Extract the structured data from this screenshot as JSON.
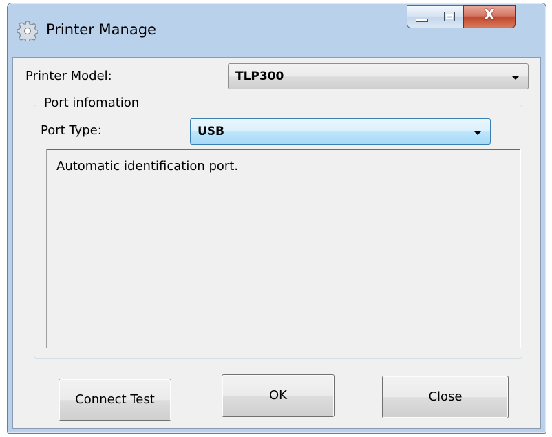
{
  "window": {
    "title": "Printer Manage",
    "icon": "gear-icon",
    "controls": {
      "minimize": "minimize-icon",
      "maximize": "maximize-icon",
      "close": "X"
    }
  },
  "form": {
    "printer_model_label": "Printer Model:",
    "printer_model_value": "TLP300",
    "port_group_title": "Port infomation",
    "port_type_label": "Port Type:",
    "port_type_value": "USB",
    "info_text": "Automatic identification port."
  },
  "buttons": {
    "connect_test": "Connect Test",
    "ok": "OK",
    "close": "Close"
  },
  "colors": {
    "frame": "#b9d1ea",
    "client": "#f0f0f0",
    "focus_border": "#3c7fb1",
    "close_button": "#c24a30"
  }
}
